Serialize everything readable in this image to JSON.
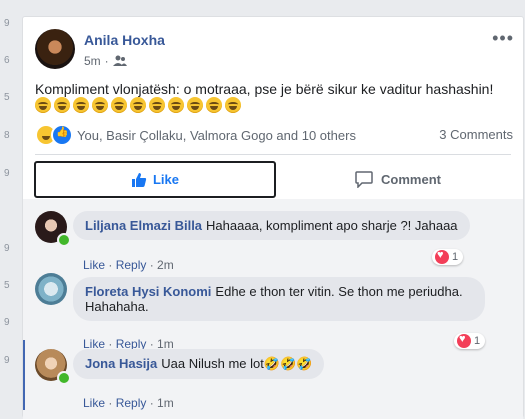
{
  "left_strip": [
    "9",
    "6",
    "5",
    "8",
    "9",
    "9",
    "5",
    "9",
    "9"
  ],
  "post": {
    "author": "Anila Hoxha",
    "time": "5m",
    "privacy_icon": "friends-icon",
    "more_icon": "more-dots-icon",
    "text": "Kompliment vlonjatësh: o motraaa, pse je bërë sikur ke vaditur hashashin!",
    "emoji_count": 11,
    "reactors": "You, Basir Çollaku, Valmora Gogo and 10 others",
    "comments_count": "3 Comments",
    "actions": {
      "like": "Like",
      "comment": "Comment"
    }
  },
  "comments": [
    {
      "author": "Liljana Elmazi Billa",
      "text": "Hahaaaa, kompliment apo sharje ?! Jahaaa",
      "like": "Like",
      "reply": "Reply",
      "time": "2m",
      "reactions": "1",
      "online": true
    },
    {
      "author": "Floreta Hysi Konomi",
      "text": "Edhe e thon ter vitin. Se thon me periudha. Hahahaha.",
      "like": "Like",
      "reply": "Reply",
      "time": "1m",
      "reactions": "1",
      "online": false
    },
    {
      "author": "Jona Hasija",
      "text": "Uaa Nilush me lot🤣🤣🤣",
      "like": "Like",
      "reply": "Reply",
      "time": "1m",
      "online": true
    }
  ],
  "colors": {
    "link": "#385898",
    "like_blue": "#1877f2",
    "heart": "#f33e58",
    "online": "#42b72a"
  }
}
